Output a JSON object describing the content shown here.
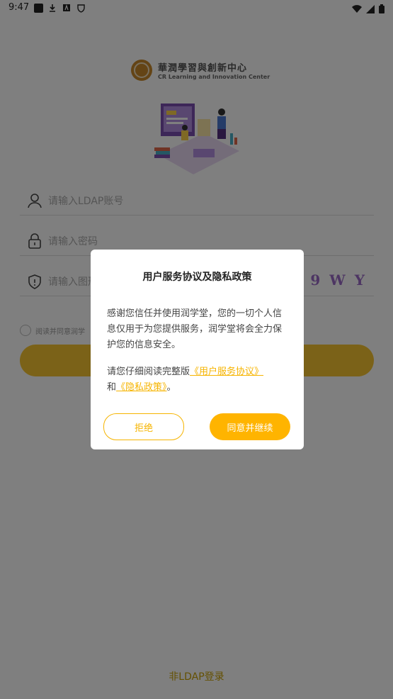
{
  "status_bar": {
    "time": "9:47",
    "left_icons": [
      "notification-square-icon",
      "download-icon",
      "a-icon",
      "shield-app-icon"
    ],
    "right_icons": [
      "wifi-icon",
      "signal-icon",
      "battery-icon"
    ]
  },
  "logo": {
    "cn": "華潤學習與創新中心",
    "en": "CR Learning and Innovation Center"
  },
  "form": {
    "ldap_placeholder": "请输入LDAP账号",
    "password_placeholder": "请输入密码",
    "captcha_placeholder": "请输入图形验证码",
    "captcha_text": "Z Z 9 W Y",
    "agree_text": "阅读并同意润学"
  },
  "non_ldap_link": "非LDAP登录",
  "dialog": {
    "title": "用户服务协议及隐私政策",
    "paragraph1": "感谢您信任并使用润学堂，您的一切个人信息仅用于为您提供服务，润学堂将会全力保护您的信息安全。",
    "p2_prefix": "请您仔细阅读完整版",
    "service_link": "《用户服务协议》",
    "p2_and": "和",
    "privacy_link": "《隐私政策》",
    "p2_suffix": "。",
    "reject_label": "拒绝",
    "accept_label": "同意并继续"
  },
  "colors": {
    "accent": "#ffb400",
    "login_button": "#f7c531",
    "overlay": "rgba(0,0,0,0.5)"
  }
}
